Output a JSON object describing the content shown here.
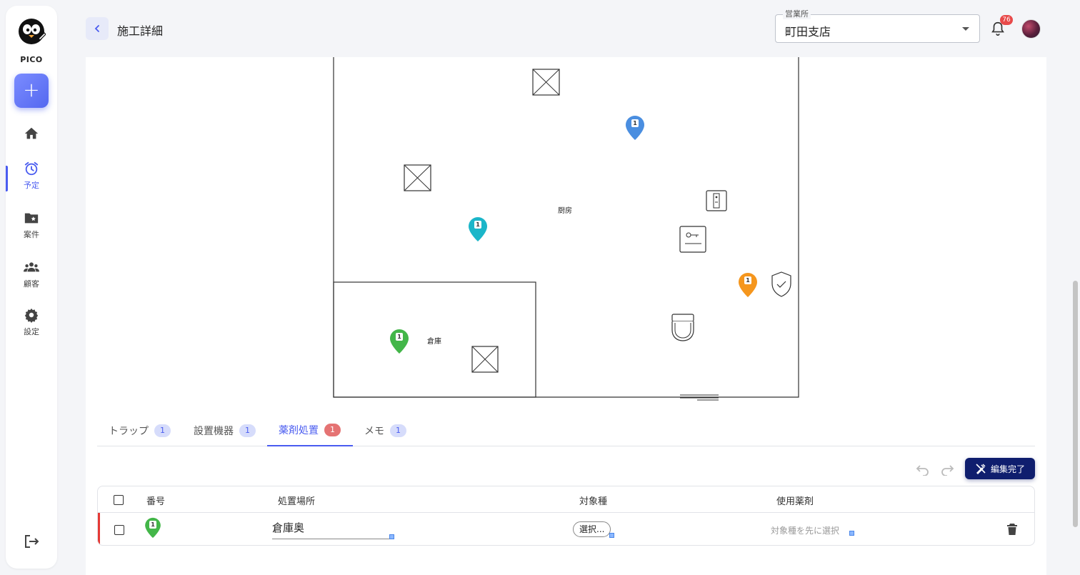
{
  "sidebar": {
    "logo_text": "PICO",
    "items": [
      {
        "label": ""
      },
      {
        "label": "予定"
      },
      {
        "label": "案件"
      },
      {
        "label": "顧客"
      },
      {
        "label": "設定"
      }
    ]
  },
  "header": {
    "title": "施工詳細",
    "branch_label": "営業所",
    "branch_value": "町田支店",
    "notification_count": "76"
  },
  "floorplan": {
    "rooms": {
      "kitchen": "厨房",
      "storage": "倉庫"
    },
    "pins": [
      {
        "number": "1",
        "color": "#4a8ee0"
      },
      {
        "number": "1",
        "color": "#1bb6c9"
      },
      {
        "number": "1",
        "color": "#f5961d"
      },
      {
        "number": "1",
        "color": "#43b649"
      }
    ]
  },
  "tabs": [
    {
      "label": "トラップ",
      "count": "1"
    },
    {
      "label": "設置機器",
      "count": "1"
    },
    {
      "label": "薬剤処置",
      "count": "1"
    },
    {
      "label": "メモ",
      "count": "1"
    }
  ],
  "toolbar": {
    "edit_done_label": "編集完了"
  },
  "table": {
    "headers": {
      "number": "番号",
      "location": "処置場所",
      "target": "対象種",
      "chemical": "使用薬剤"
    },
    "rows": [
      {
        "pin_number": "1",
        "location": "倉庫奥",
        "target_button": "選択...",
        "chemical_placeholder": "対象種を先に選択"
      }
    ]
  },
  "colors": {
    "accent": "#4a5cf0",
    "edit_done_bg": "#0f1e6e",
    "row_accent": "#e53935",
    "active_tab_badge": "#e57373"
  }
}
